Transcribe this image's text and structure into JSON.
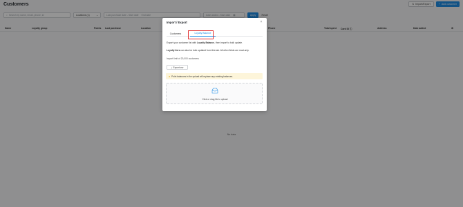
{
  "page": {
    "title": "Customers",
    "import_export_label": "Import/Export",
    "add_customer_label": "Add customer"
  },
  "filters": {
    "search_placeholder": "Search by name, email, phone, id",
    "location_value": "Locations (1)",
    "date_start_placeholder": "Last purchase date - Start date",
    "date_end_placeholder": "End date",
    "date_added_placeholder": "Date added - Start date",
    "apply_label": "Apply",
    "reset_label": "Reset"
  },
  "table": {
    "columns": [
      "Name",
      "Loyalty group",
      "Points",
      "Last purchase",
      "Location",
      "Phone",
      "Total spent",
      "Card ID",
      "Address",
      "Date added"
    ],
    "empty_text": "No data"
  },
  "modal": {
    "title": "Import / Export",
    "close_symbol": "×",
    "tabs": [
      {
        "label": "Customers",
        "active": false
      },
      {
        "label": "Loyalty Balance",
        "active": true
      }
    ],
    "line1_pre": "Export your customer list with ",
    "line1_bold": "Loyalty Balance",
    "line1_post": ", then import to bulk update.",
    "line2_bold": "Loyalty tiers",
    "line2_post": " can also be bulk updated from this tab. All other fields are read-only.",
    "limit_text": "Import limit of 20,000 customers",
    "export_label": "Export csv",
    "warning_text": "Point balances in the upload will replace any existing balances.",
    "upload_text": "Click or drag file to upload"
  },
  "colors": {
    "accent": "#1f8de6",
    "highlight": "#e02b2b",
    "warning_bg": "#fdf5da"
  },
  "icons": [
    "import-export-icon",
    "plus-icon",
    "search-icon",
    "chevron-down-icon",
    "calendar-icon",
    "info-icon",
    "gear-icon",
    "close-icon",
    "download-icon",
    "warning-icon",
    "inbox-upload-icon"
  ]
}
